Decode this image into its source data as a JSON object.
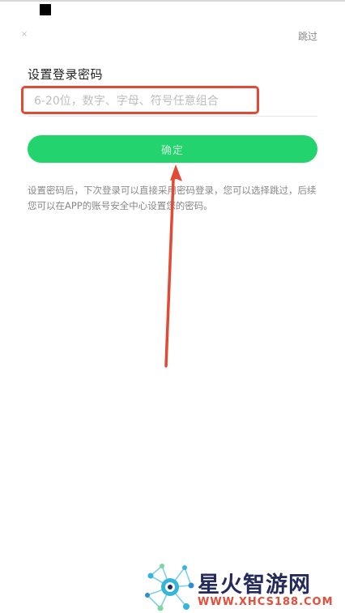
{
  "topbar": {
    "close_icon": "close-icon",
    "close_glyph": "×",
    "skip_label": "跳过"
  },
  "form": {
    "title": "设置登录密码",
    "password_placeholder": "6-20位，数字、字母、符号任意组合",
    "password_value": "",
    "confirm_label": "确定",
    "hint_text": "设置密码后，下次登录可以直接采用密码登录，您可以选择跳过，后续您可以在APP的账号安全中心设置您的密码。"
  },
  "annotation": {
    "box_color": "#e24a33",
    "arrow_color": "#e24a33"
  },
  "watermark": {
    "brand": "星火智游网",
    "url": "WWW.XHCS188.COM",
    "brand_color": "#252a5c",
    "url_color": "#e64d3a"
  },
  "colors": {
    "accent": "#23d36d",
    "button_text": "#c6f3d6"
  }
}
